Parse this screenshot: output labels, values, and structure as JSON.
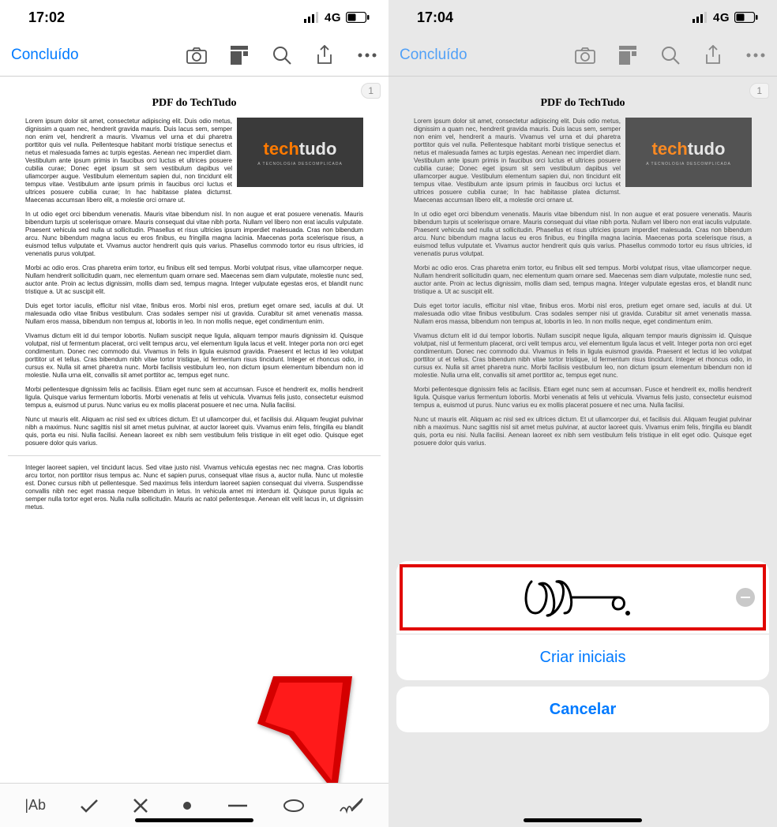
{
  "left": {
    "status": {
      "time": "17:02",
      "network": "4G"
    },
    "toolbar": {
      "done_label": "Concluído"
    },
    "page_badge": "1",
    "doc": {
      "title": "PDF do TechTudo",
      "logo_brand_a": "tech",
      "logo_brand_b": "tudo",
      "logo_tagline": "A TECNOLOGIA DESCOMPLICADA",
      "p1": "Lorem ipsum dolor sit amet, consectetur adipiscing elit. Duis odio metus, dignissim a quam nec, hendrerit gravida mauris. Duis lacus sem, semper non enim vel, hendrerit a mauris. Vivamus vel urna et dui pharetra porttitor quis vel nulla. Pellentesque habitant morbi tristique senectus et netus et malesuada fames ac turpis egestas. Aenean nec imperdiet diam. Vestibulum ante ipsum primis in faucibus orci luctus et ultrices posuere cubilia curae; Donec eget ipsum sit sem vestibulum dapibus vel ullamcorper augue. Vestibulum elementum sapien dui, non tincidunt elit tempus vitae. Vestibulum ante ipsum primis in faucibus orci luctus et ultrices posuere cubilia curae; In hac habitasse platea dictumst. Maecenas accumsan libero elit, a molestie orci ornare ut.",
      "p2": "In ut odio eget orci bibendum venenatis. Mauris vitae bibendum nisl. In non augue et erat posuere venenatis. Mauris bibendum turpis ut scelerisque ornare. Mauris consequat dui vitae nibh porta. Nullam vel libero non erat iaculis vulputate. Praesent vehicula sed nulla ut sollicitudin. Phasellus et risus ultricies ipsum imperdiet malesuada. Cras non bibendum arcu. Nunc bibendum magna lacus eu eros finibus, eu fringilla magna lacinia. Maecenas porta scelerisque risus, a euismod tellus vulputate et. Vivamus auctor hendrerit quis quis varius. Phasellus commodo tortor eu risus ultricies, id venenatis purus volutpat.",
      "p3": "Morbi ac odio eros. Cras pharetra enim tortor, eu finibus elit sed tempus. Morbi volutpat risus, vitae ullamcorper neque. Nullam hendrerit sollicitudin quam, nec elementum quam ornare sed. Maecenas sem diam vulputate, molestie nunc sed, auctor ante. Proin ac lectus dignissim, mollis diam sed, tempus magna. Integer vulputate egestas eros, et blandit nunc tristique a. Ut ac suscipit elit.",
      "p4": "Duis eget tortor iaculis, efficitur nisl vitae, finibus eros. Morbi nisl eros, pretium eget ornare sed, iaculis at dui. Ut malesuada odio vitae finibus vestibulum. Cras sodales semper nisi ut gravida. Curabitur sit amet venenatis massa. Nullam eros massa, bibendum non tempus at, lobortis in leo. In non mollis neque, eget condimentum enim.",
      "p5": "Vivamus dictum elit id dui tempor lobortis. Nullam suscipit neque ligula, aliquam tempor mauris dignissim id. Quisque volutpat, nisl ut fermentum placerat, orci velit tempus arcu, vel elementum ligula lacus et velit. Integer porta non orci eget condimentum. Donec nec commodo dui. Vivamus in felis in ligula euismod gravida. Praesent et lectus id leo volutpat porttitor ut et tellus. Cras bibendum nibh vitae tortor tristique, id fermentum risus tincidunt. Integer et rhoncus odio, in cursus ex. Nulla sit amet pharetra nunc. Morbi facilisis vestibulum leo, non dictum ipsum elementum bibendum non id molestie. Nulla urna elit, convallis sit amet porttitor ac, tempus eget nunc.",
      "p6": "Morbi pellentesque dignissim felis ac facilisis. Etiam eget nunc sem at accumsan. Fusce et hendrerit ex, mollis hendrerit ligula. Quisque varius fermentum lobortis. Morbi venenatis at felis ut vehicula. Vivamus felis justo, consectetur euismod tempus a, euismod ut purus. Nunc varius eu ex mollis placerat posuere et nec urna. Nulla facilisi.",
      "p7": "Nunc ut mauris elit. Aliquam ac nisl sed ex ultrices dictum. Et ut ullamcorper dui, et facilisis dui. Aliquam feugiat pulvinar nibh a maximus. Nunc sagittis nisl sit amet metus pulvinar, at auctor laoreet quis. Vivamus enim felis, fringilla eu blandit quis, porta eu nisi. Nulla facilisi. Aenean laoreet ex nibh sem vestibulum felis tristique in elit eget odio. Quisque eget posuere dolor quis varius.",
      "p8": "Integer laoreet sapien, vel tincidunt lacus. Sed vitae justo nisl. Vivamus vehicula egestas nec nec magna. Cras lobortis arcu tortor, non porttitor risus tempus ac. Nunc et sapien purus, consequat vitae risus a, auctor nulla. Nunc ut molestie est. Donec cursus nibh ut pellentesque. Sed maximus felis interdum laoreet sapien consequat dui viverra. Suspendisse convallis nibh nec eget massa neque bibendum in letus. In vehicula amet mi interdum id. Quisque purus ligula ac semper nulla tortor eget eros. Nulla nulla sollicitudin. Mauris ac natol pellentesque. Aenean elit velit lacus in, ut dignissim metus."
    }
  },
  "right": {
    "status": {
      "time": "17:04",
      "network": "4G"
    },
    "toolbar": {
      "done_label": "Concluído"
    },
    "sheet": {
      "create_initials": "Criar iniciais",
      "cancel": "Cancelar"
    }
  },
  "colors": {
    "accent": "#007AFF",
    "highlight": "#e10600",
    "logo_orange": "#ff7a00"
  }
}
